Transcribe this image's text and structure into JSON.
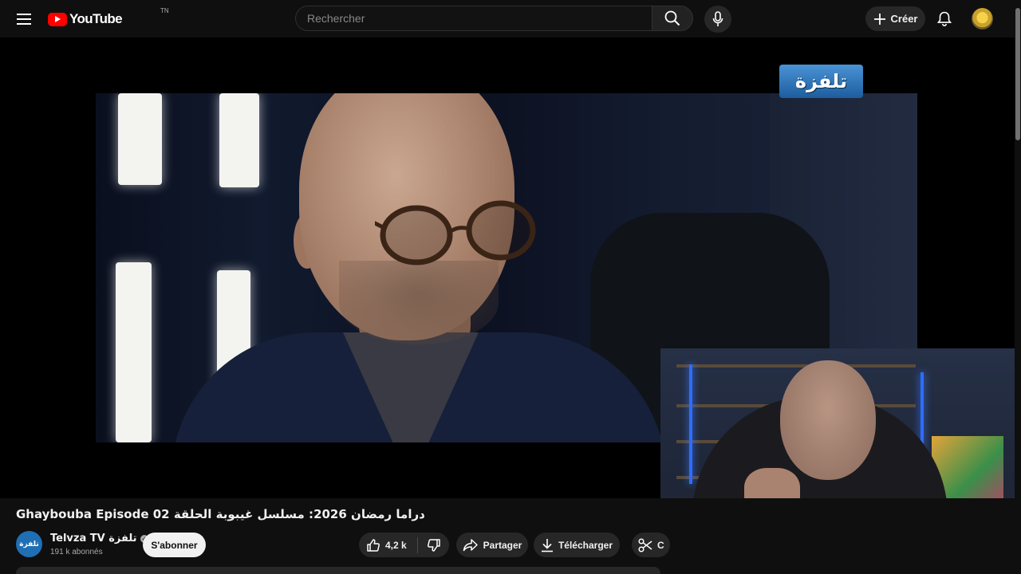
{
  "header": {
    "logo_text": "YouTube",
    "country_code": "TN",
    "search_placeholder": "Rechercher",
    "create_label": "Créer"
  },
  "video": {
    "overlay_logo_text": "تلفزة",
    "title": "دراما رمضان 2026: مسلسل غيبوبة الحلقة Ghaybouba Episode 02"
  },
  "channel": {
    "name": "Telvza TV تلفزة",
    "avatar_text": "تلفزة",
    "subscribers": "191 k abonnés",
    "subscribe_label": "S'abonner"
  },
  "actions": {
    "likes": "4,2 k",
    "share_label": "Partager",
    "download_label": "Télécharger",
    "clip_label": "C"
  },
  "icons": {
    "menu": "hamburger-menu-icon",
    "search": "search-icon",
    "mic": "microphone-icon",
    "create": "plus-icon",
    "bell": "bell-icon",
    "like": "thumbs-up-icon",
    "dislike": "thumbs-down-icon",
    "share": "share-arrow-icon",
    "download": "download-icon",
    "clip": "scissors-icon"
  },
  "colors": {
    "background": "#0f0f0f",
    "brand_red": "#ff0000",
    "pill": "#272727",
    "subscribe_bg": "#f1f1f1"
  }
}
